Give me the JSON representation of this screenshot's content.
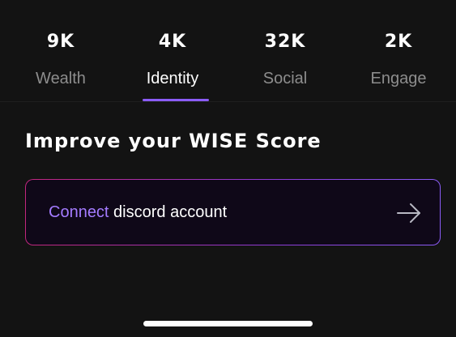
{
  "tabs": [
    {
      "value": "9K",
      "label": "Wealth",
      "active": false
    },
    {
      "value": "4K",
      "label": "Identity",
      "active": true
    },
    {
      "value": "32K",
      "label": "Social",
      "active": false
    },
    {
      "value": "2K",
      "label": "Engage",
      "active": false
    }
  ],
  "section": {
    "title": "Improve your WISE Score"
  },
  "card": {
    "accent_text": "Connect",
    "rest_text": " discord account",
    "arrow_icon": "arrow-right-icon"
  },
  "colors": {
    "background": "#131313",
    "accent": "#8b5cf6",
    "accent_text": "#a47bff",
    "gradient_start": "#c2267d"
  }
}
